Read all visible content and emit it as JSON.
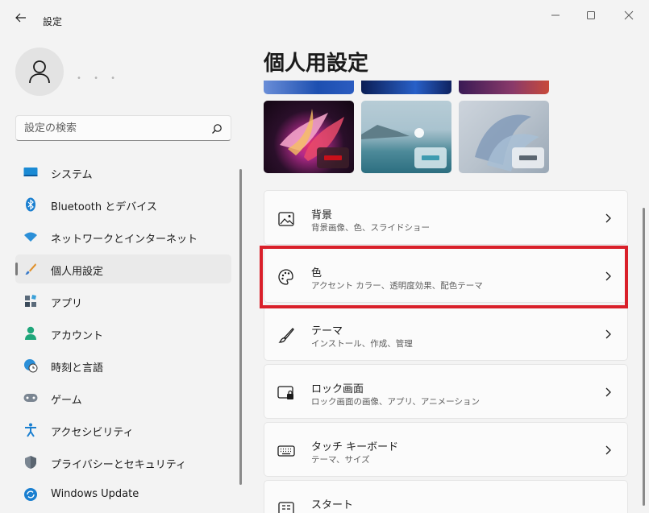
{
  "window": {
    "title": "設定",
    "back_icon": "arrow-left-icon",
    "controls": [
      "minimize-icon",
      "maximize-icon",
      "close-icon"
    ]
  },
  "account": {
    "avatar_icon": "person-icon",
    "name": "• • •"
  },
  "search": {
    "placeholder": "設定の検索",
    "value": "",
    "icon": "search-icon"
  },
  "sidebar": {
    "items": [
      {
        "label": "システム",
        "icon": "monitor-icon"
      },
      {
        "label": "Bluetooth とデバイス",
        "icon": "bluetooth-icon"
      },
      {
        "label": "ネットワークとインターネット",
        "icon": "wifi-icon"
      },
      {
        "label": "個人用設定",
        "icon": "brush-icon",
        "selected": true
      },
      {
        "label": "アプリ",
        "icon": "apps-icon"
      },
      {
        "label": "アカウント",
        "icon": "account-icon"
      },
      {
        "label": "時刻と言語",
        "icon": "globe-clock-icon"
      },
      {
        "label": "ゲーム",
        "icon": "gamepad-icon"
      },
      {
        "label": "アクセシビリティ",
        "icon": "accessibility-icon"
      },
      {
        "label": "プライバシーとセキュリティ",
        "icon": "shield-icon"
      },
      {
        "label": "Windows Update",
        "icon": "update-icon"
      }
    ]
  },
  "main": {
    "title": "個人用設定",
    "themes": [
      {
        "name": "glow",
        "accent": "#c8101a"
      },
      {
        "name": "sunrise",
        "accent": "#3e9bb0"
      },
      {
        "name": "flow",
        "accent": "#5a6570"
      }
    ],
    "cards": [
      {
        "title": "背景",
        "subtitle": "背景画像、色、スライドショー",
        "icon": "image-icon"
      },
      {
        "title": "色",
        "subtitle": "アクセント カラー、透明度効果、配色テーマ",
        "icon": "palette-icon"
      },
      {
        "title": "テーマ",
        "subtitle": "インストール、作成、管理",
        "icon": "brush-icon"
      },
      {
        "title": "ロック画面",
        "subtitle": "ロック画面の画像、アプリ、アニメーション",
        "icon": "lock-screen-icon"
      },
      {
        "title": "タッチ キーボード",
        "subtitle": "テーマ、サイズ",
        "icon": "keyboard-icon"
      },
      {
        "title": "スタート",
        "subtitle": "",
        "icon": "start-icon"
      }
    ]
  },
  "colors": {
    "highlight": "#d9202a",
    "background": "#f3f3f3"
  }
}
